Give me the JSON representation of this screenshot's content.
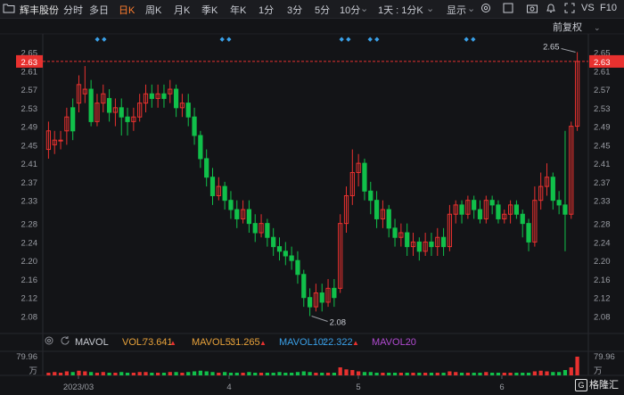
{
  "toolbar": {
    "stock_name": "辉丰股份",
    "tabs": [
      "分时",
      "多日",
      "日K",
      "周K",
      "月K",
      "季K",
      "年K",
      "1分",
      "3分",
      "5分",
      "10分",
      "1天 : 1分K"
    ],
    "active_tab": "日K",
    "display_label": "显示",
    "right_labels": [
      "VS",
      "F10"
    ]
  },
  "chart_header": {
    "adjust_label": "前复权"
  },
  "colors": {
    "up": "#e8312f",
    "down": "#11c04a",
    "bg": "#131417",
    "grid": "#2a2b30",
    "price_line": "#e8312f"
  },
  "chart_data": {
    "type": "candlestick",
    "y_ticks": [
      "2.65",
      "2.61",
      "2.57",
      "2.53",
      "2.49",
      "2.45",
      "2.41",
      "2.37",
      "2.33",
      "2.28",
      "2.24",
      "2.20",
      "2.16",
      "2.12",
      "2.08"
    ],
    "ylim": [
      2.05,
      2.67
    ],
    "x_labels": [
      "2023/03",
      "4",
      "5",
      "6"
    ],
    "current_price": "2.63",
    "high_label": "2.65",
    "low_label": "2.08",
    "candles": [
      [
        2.44,
        2.48,
        2.42,
        2.5
      ],
      [
        2.45,
        2.46,
        2.43,
        2.48
      ],
      [
        2.46,
        2.46,
        2.44,
        2.48
      ],
      [
        2.48,
        2.51,
        2.45,
        2.53
      ],
      [
        2.53,
        2.48,
        2.46,
        2.55
      ],
      [
        2.54,
        2.58,
        2.52,
        2.6
      ],
      [
        2.56,
        2.57,
        2.54,
        2.62
      ],
      [
        2.57,
        2.5,
        2.49,
        2.59
      ],
      [
        2.5,
        2.54,
        2.49,
        2.56
      ],
      [
        2.54,
        2.56,
        2.52,
        2.58
      ],
      [
        2.55,
        2.52,
        2.5,
        2.57
      ],
      [
        2.52,
        2.53,
        2.49,
        2.55
      ],
      [
        2.53,
        2.51,
        2.47,
        2.55
      ],
      [
        2.51,
        2.5,
        2.47,
        2.53
      ],
      [
        2.5,
        2.51,
        2.48,
        2.53
      ],
      [
        2.51,
        2.54,
        2.5,
        2.56
      ],
      [
        2.54,
        2.56,
        2.52,
        2.58
      ],
      [
        2.56,
        2.55,
        2.53,
        2.58
      ],
      [
        2.55,
        2.56,
        2.53,
        2.58
      ],
      [
        2.56,
        2.55,
        2.53,
        2.58
      ],
      [
        2.56,
        2.57,
        2.54,
        2.59
      ],
      [
        2.57,
        2.53,
        2.51,
        2.58
      ],
      [
        2.53,
        2.54,
        2.51,
        2.56
      ],
      [
        2.54,
        2.51,
        2.49,
        2.56
      ],
      [
        2.51,
        2.47,
        2.45,
        2.53
      ],
      [
        2.47,
        2.42,
        2.4,
        2.48
      ],
      [
        2.42,
        2.38,
        2.36,
        2.44
      ],
      [
        2.38,
        2.34,
        2.32,
        2.4
      ],
      [
        2.34,
        2.36,
        2.33,
        2.38
      ],
      [
        2.36,
        2.33,
        2.31,
        2.37
      ],
      [
        2.33,
        2.31,
        2.29,
        2.35
      ],
      [
        2.31,
        2.29,
        2.27,
        2.33
      ],
      [
        2.29,
        2.31,
        2.28,
        2.33
      ],
      [
        2.31,
        2.28,
        2.26,
        2.33
      ],
      [
        2.28,
        2.26,
        2.24,
        2.3
      ],
      [
        2.26,
        2.28,
        2.25,
        2.3
      ],
      [
        2.28,
        2.25,
        2.23,
        2.29
      ],
      [
        2.25,
        2.23,
        2.21,
        2.27
      ],
      [
        2.23,
        2.22,
        2.2,
        2.25
      ],
      [
        2.22,
        2.21,
        2.19,
        2.24
      ],
      [
        2.21,
        2.2,
        2.18,
        2.23
      ],
      [
        2.2,
        2.17,
        2.15,
        2.22
      ],
      [
        2.17,
        2.12,
        2.1,
        2.18
      ],
      [
        2.12,
        2.1,
        2.08,
        2.14
      ],
      [
        2.1,
        2.13,
        2.09,
        2.15
      ],
      [
        2.13,
        2.11,
        2.09,
        2.15
      ],
      [
        2.11,
        2.14,
        2.1,
        2.16
      ],
      [
        2.14,
        2.12,
        2.1,
        2.16
      ],
      [
        2.14,
        2.28,
        2.13,
        2.3
      ],
      [
        2.28,
        2.34,
        2.26,
        2.36
      ],
      [
        2.34,
        2.39,
        2.32,
        2.44
      ],
      [
        2.39,
        2.41,
        2.36,
        2.43
      ],
      [
        2.41,
        2.35,
        2.33,
        2.42
      ],
      [
        2.35,
        2.33,
        2.3,
        2.37
      ],
      [
        2.33,
        2.29,
        2.27,
        2.35
      ],
      [
        2.29,
        2.31,
        2.27,
        2.33
      ],
      [
        2.31,
        2.27,
        2.25,
        2.32
      ],
      [
        2.27,
        2.25,
        2.23,
        2.29
      ],
      [
        2.25,
        2.26,
        2.23,
        2.28
      ],
      [
        2.26,
        2.23,
        2.21,
        2.28
      ],
      [
        2.23,
        2.24,
        2.21,
        2.26
      ],
      [
        2.24,
        2.22,
        2.2,
        2.25
      ],
      [
        2.22,
        2.24,
        2.21,
        2.26
      ],
      [
        2.24,
        2.23,
        2.21,
        2.26
      ],
      [
        2.23,
        2.25,
        2.21,
        2.27
      ],
      [
        2.25,
        2.23,
        2.21,
        2.27
      ],
      [
        2.23,
        2.3,
        2.22,
        2.32
      ],
      [
        2.3,
        2.32,
        2.28,
        2.33
      ],
      [
        2.32,
        2.3,
        2.28,
        2.33
      ],
      [
        2.3,
        2.33,
        2.29,
        2.34
      ],
      [
        2.33,
        2.31,
        2.29,
        2.34
      ],
      [
        2.31,
        2.29,
        2.28,
        2.33
      ],
      [
        2.29,
        2.33,
        2.28,
        2.34
      ],
      [
        2.33,
        2.32,
        2.3,
        2.34
      ],
      [
        2.32,
        2.29,
        2.28,
        2.33
      ],
      [
        2.29,
        2.3,
        2.28,
        2.31
      ],
      [
        2.3,
        2.32,
        2.28,
        2.33
      ],
      [
        2.32,
        2.3,
        2.29,
        2.33
      ],
      [
        2.3,
        2.28,
        2.25,
        2.31
      ],
      [
        2.28,
        2.24,
        2.22,
        2.29
      ],
      [
        2.24,
        2.33,
        2.23,
        2.36
      ],
      [
        2.33,
        2.36,
        2.31,
        2.39
      ],
      [
        2.36,
        2.38,
        2.34,
        2.41
      ],
      [
        2.38,
        2.33,
        2.31,
        2.39
      ],
      [
        2.33,
        2.32,
        2.3,
        2.35
      ],
      [
        2.32,
        2.3,
        2.22,
        2.48
      ],
      [
        2.3,
        2.49,
        2.29,
        2.5
      ],
      [
        2.49,
        2.63,
        2.48,
        2.65
      ]
    ],
    "volumes": [
      4,
      5,
      4,
      6,
      5,
      7,
      6,
      5,
      4,
      5,
      4,
      4,
      5,
      4,
      4,
      5,
      5,
      4,
      4,
      4,
      5,
      5,
      4,
      5,
      6,
      7,
      6,
      5,
      4,
      5,
      4,
      4,
      4,
      5,
      4,
      4,
      4,
      4,
      5,
      4,
      4,
      5,
      6,
      5,
      4,
      4,
      4,
      4,
      12,
      9,
      8,
      6,
      5,
      5,
      4,
      4,
      4,
      4,
      4,
      4,
      4,
      4,
      4,
      4,
      4,
      4,
      6,
      5,
      4,
      4,
      4,
      4,
      5,
      4,
      4,
      4,
      4,
      4,
      4,
      4,
      6,
      7,
      6,
      5,
      5,
      8,
      12,
      28
    ],
    "vol_max_label": "79.96",
    "vol_unit_label": "万"
  },
  "indicator": {
    "name": "MAVOL",
    "vol_label": "VOL:",
    "vol_value": "73.641",
    "mavol5_label": "MAVOL5:",
    "mavol5_value": "31.265",
    "mavol10_label": "MAVOL10:",
    "mavol10_value": "22.322",
    "mavol20_label": "MAVOL20",
    "mavol5_color": "#e8a23a",
    "mavol10_color": "#3aa0e8",
    "mavol20_color": "#b04ad0"
  },
  "watermark": "格隆汇"
}
